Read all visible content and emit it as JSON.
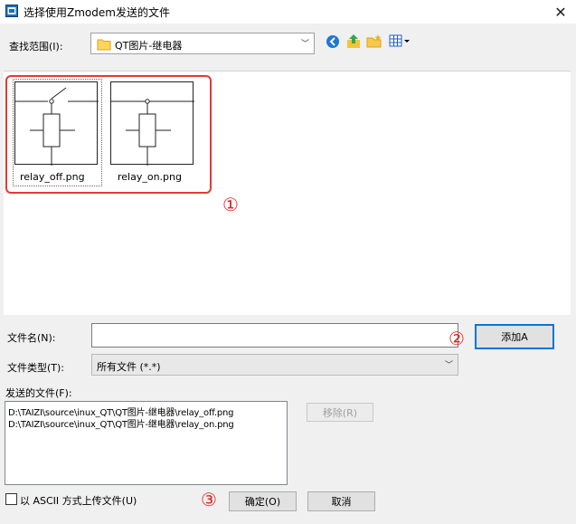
{
  "window": {
    "title": "选择使用Zmodem发送的文件",
    "close_glyph": "✕"
  },
  "lookin": {
    "label": "查找范围(I):",
    "value": "QT图片-继电器"
  },
  "toolbar": {
    "icons": [
      "back-icon",
      "up-folder-icon",
      "new-folder-icon",
      "view-menu-icon"
    ]
  },
  "files": [
    {
      "name": "relay_off.png",
      "switch": "open"
    },
    {
      "name": "relay_on.png",
      "switch": "closed"
    }
  ],
  "annotations": {
    "one": "①",
    "two": "②",
    "three": "③",
    "color": "#e53935"
  },
  "filename": {
    "label": "文件名(N):",
    "value": ""
  },
  "filetype": {
    "label": "文件类型(T):",
    "value": "所有文件 (*.*)"
  },
  "add_button": "添加A",
  "sent": {
    "label": "发送的文件(F):",
    "items": [
      "D:\\TAIZI\\source\\inux_QT\\QT图片-继电器\\relay_off.png",
      "D:\\TAIZI\\source\\inux_QT\\QT图片-继电器\\relay_on.png"
    ],
    "remove_button": "移除(R)"
  },
  "ascii": {
    "label": "以 ASCII 方式上传文件(U)",
    "checked": false
  },
  "ok_button": "确定(O)",
  "cancel_button": "取消"
}
